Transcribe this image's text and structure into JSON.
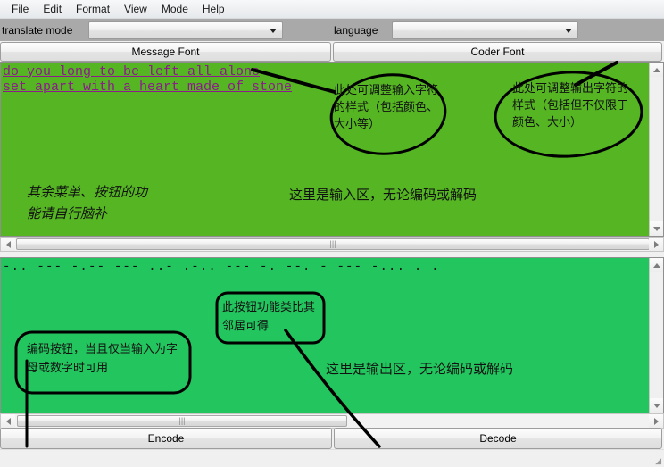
{
  "window": {
    "menu": [
      {
        "label": "File"
      },
      {
        "label": "Edit"
      },
      {
        "label": "Format"
      },
      {
        "label": "View"
      },
      {
        "label": "Mode"
      },
      {
        "label": "Help"
      }
    ]
  },
  "toolbar": {
    "translate_mode_label": "translate mode",
    "translate_mode_value": "",
    "translate_mode_placeholder": "",
    "language_label": "language",
    "language_value": "",
    "language_placeholder": "",
    "message_font_button": "Message Font",
    "coder_font_button": "Coder Font"
  },
  "input_area": {
    "text": "do you long to be left all alone\nset apart with a heart made of stone",
    "background_color": "#55b522",
    "text_color": "#8e1a8e"
  },
  "output_area": {
    "text": "-.. --- -.-- --- ..- .-.. --- -. --. - --- -... . .",
    "background_color": "#22c55e",
    "text_color": "#111111"
  },
  "buttons": {
    "encode": "Encode",
    "decode": "Decode"
  },
  "scrollbars": {
    "up_arrow": "scroll-up",
    "down_arrow": "scroll-down",
    "left_arrow": "scroll-left",
    "right_arrow": "scroll-right",
    "grip": "|||"
  },
  "annotations": {
    "input_style": "此处可调整输入字符的样式（包括颜色、大小等）",
    "output_style": "此处可调整输出字符的样式（包括但不仅限于颜色、大小）",
    "misc_menus": "其余菜单、按钮的功能请自行脑补",
    "input_area": "这里是输入区，无论编码或解码",
    "output_area": "这里是输出区，无论编码或解码",
    "encode_button": "编码按钮，当且仅当输入为字母或数字时可用",
    "decode_button": "此按钮功能类比其邻居可得"
  },
  "status": {
    "resize_grip": "◢"
  }
}
